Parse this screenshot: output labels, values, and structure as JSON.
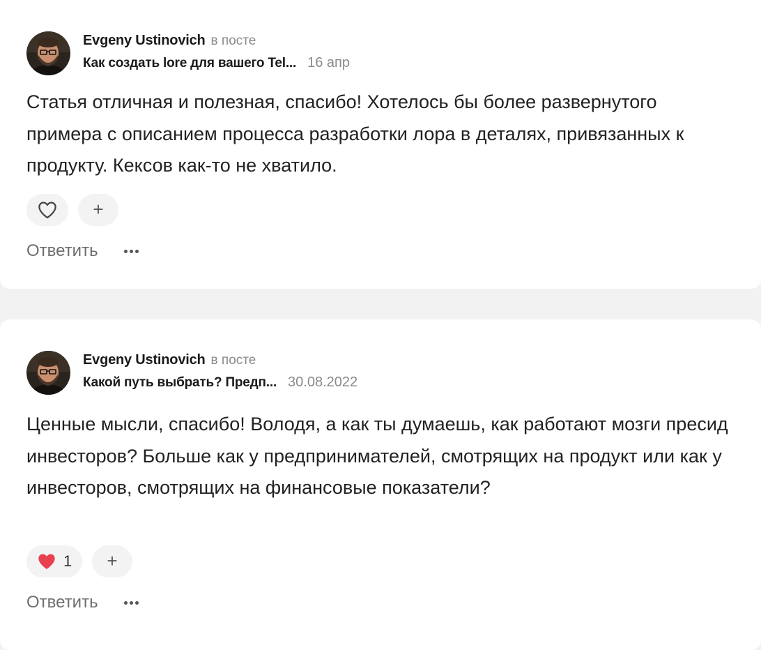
{
  "comments": [
    {
      "author": "Evgeny Ustinovich",
      "in_post_label": "в посте",
      "post_title": "Как создать lore для вашего Tel...",
      "date": "16 апр",
      "text": "Статья отличная и полезная, спасибо! Хотелось бы более развернутого примера с описанием процесса разработки лора в деталях, привязанных к продукту. Кексов как-то не хватило.",
      "liked": false,
      "like_count": "",
      "reply_label": "Ответить",
      "icons": {
        "like": "heart-outline-icon",
        "add": "plus-icon",
        "more": "more-dots-icon"
      }
    },
    {
      "author": "Evgeny Ustinovich",
      "in_post_label": "в посте",
      "post_title": "Какой путь выбрать? Предп...",
      "date": "30.08.2022",
      "text": "Ценные мысли, спасибо! Володя, а как ты думаешь, как работают мозги пресид инвесторов? Больше как у предпринимателей, смотрящих на продукт или как у инвесторов, смотрящих на финансовые показатели?",
      "liked": true,
      "like_count": "1",
      "reply_label": "Ответить",
      "icons": {
        "like": "heart-filled-icon",
        "add": "plus-icon",
        "more": "more-dots-icon"
      }
    }
  ],
  "colors": {
    "page_background": "#f2f2f2",
    "card_background": "#ffffff",
    "liked_heart": "#e8404f",
    "muted_text": "#8a8a8a"
  }
}
